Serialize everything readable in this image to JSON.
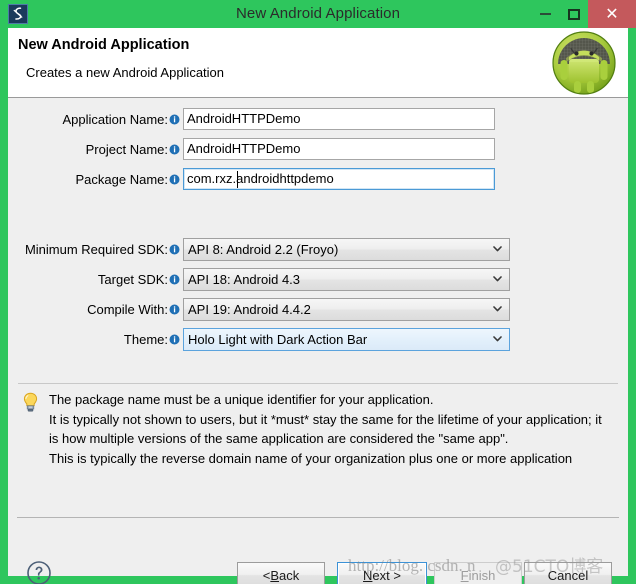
{
  "window": {
    "title": "New Android Application",
    "icon": "eclipse-icon",
    "controls": {
      "minimize": "minimize-icon",
      "maximize": "maximize-icon",
      "close": "close-icon",
      "close_glyph": "✕"
    },
    "frame_color": "#2ec65d",
    "close_color": "#c4595c"
  },
  "header": {
    "title": "New Android Application",
    "subtitle": "Creates a new Android Application",
    "logo": "android-logo-icon"
  },
  "form": {
    "info_icon": "info-icon",
    "text_fields": [
      {
        "label": "Application Name:",
        "value": "AndroidHTTPDemo",
        "focused": false,
        "name": "application-name-input"
      },
      {
        "label": "Project Name:",
        "value": "AndroidHTTPDemo",
        "focused": false,
        "name": "project-name-input"
      },
      {
        "label": "Package Name:",
        "value_before_caret": "com.rxz",
        "value_after_caret": ".androidhttpdemo",
        "value": "com.rxz.androidhttpdemo",
        "focused": true,
        "name": "package-name-input"
      }
    ],
    "combos": [
      {
        "label": "Minimum Required SDK:",
        "value": "API 8: Android 2.2 (Froyo)",
        "focused": false,
        "name": "minimum-required-sdk-select"
      },
      {
        "label": "Target SDK:",
        "value": "API 18: Android 4.3",
        "focused": false,
        "name": "target-sdk-select"
      },
      {
        "label": "Compile With:",
        "value": "API 19: Android 4.4.2",
        "focused": false,
        "name": "compile-with-select"
      },
      {
        "label": "Theme:",
        "value": "Holo Light with Dark Action Bar",
        "focused": true,
        "name": "theme-select"
      }
    ]
  },
  "tip": {
    "icon": "lightbulb-icon",
    "lines": [
      "The package name must be a unique identifier for your application.",
      "It is typically not shown to users, but it *must* stay the same for the lifetime of your application; it",
      "is how multiple versions of the same application are considered the \"same app\".",
      "This is typically the reverse domain name of your organization plus one or more application"
    ]
  },
  "buttons": {
    "help": "help-icon",
    "back": {
      "prefix": "< ",
      "mnemonic": "B",
      "suffix": "ack"
    },
    "next": {
      "prefix": "",
      "mnemonic": "N",
      "suffix": "ext >"
    },
    "finish": {
      "prefix": "",
      "mnemonic": "F",
      "suffix": "inish"
    },
    "cancel": {
      "prefix": "",
      "mnemonic": "",
      "suffix": "Cancel"
    }
  },
  "watermark": {
    "url": "http://blog. csdn. n",
    "cto": "@51CTO博客"
  }
}
